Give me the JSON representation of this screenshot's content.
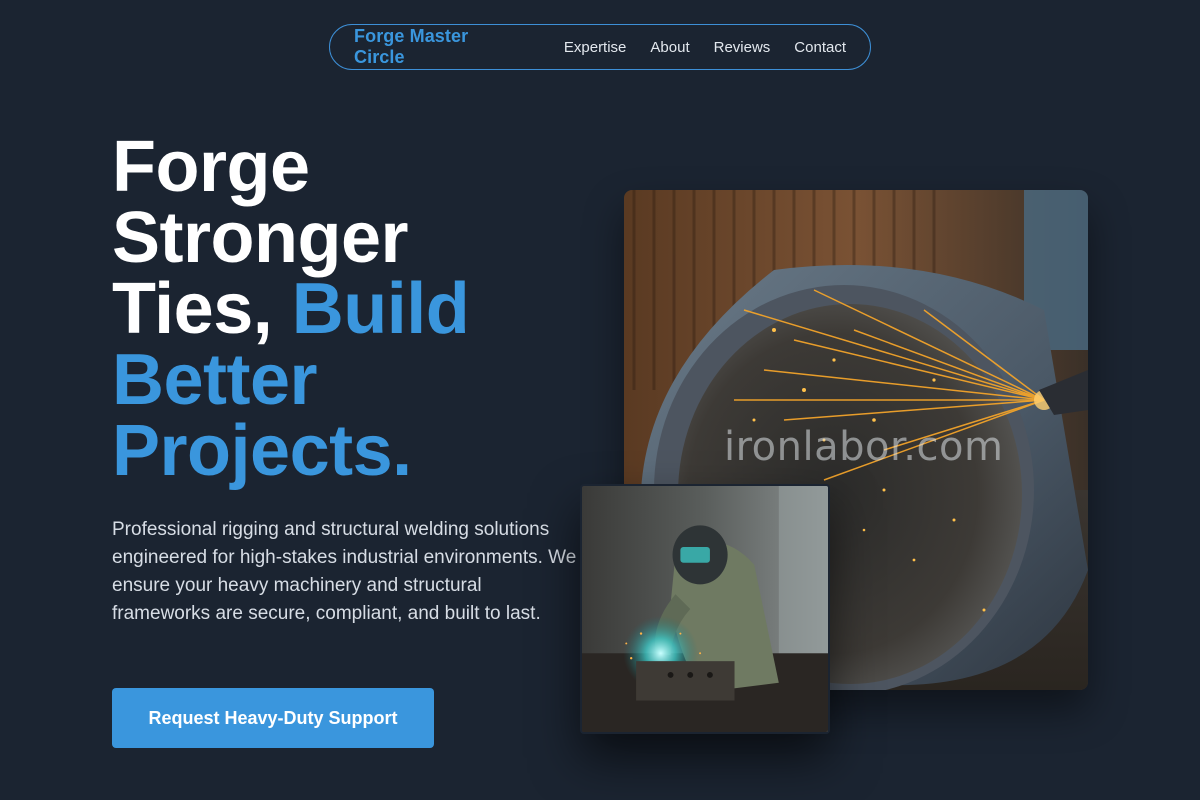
{
  "nav": {
    "brand": "Forge Master Circle",
    "links": [
      {
        "label": "Expertise"
      },
      {
        "label": "About"
      },
      {
        "label": "Reviews"
      },
      {
        "label": "Contact"
      }
    ]
  },
  "hero": {
    "headline_plain": "Forge Stronger Ties, ",
    "headline_accent": "Build Better Projects.",
    "description": "Professional rigging and structural welding solutions engineered for high-stakes industrial environments. We ensure your heavy machinery and structural frameworks are secure, compliant, and built to last.",
    "cta_label": "Request Heavy-Duty Support"
  },
  "media": {
    "main_image_watermark": "ironlabor.com",
    "main_image_subject": "grinding-sparks-steel-pipe-photo",
    "inset_image_subject": "welder-at-work-photo"
  },
  "colors": {
    "background": "#1b2431",
    "accent": "#3a96dd",
    "text_primary": "#ffffff",
    "text_secondary": "#d7dde5"
  }
}
